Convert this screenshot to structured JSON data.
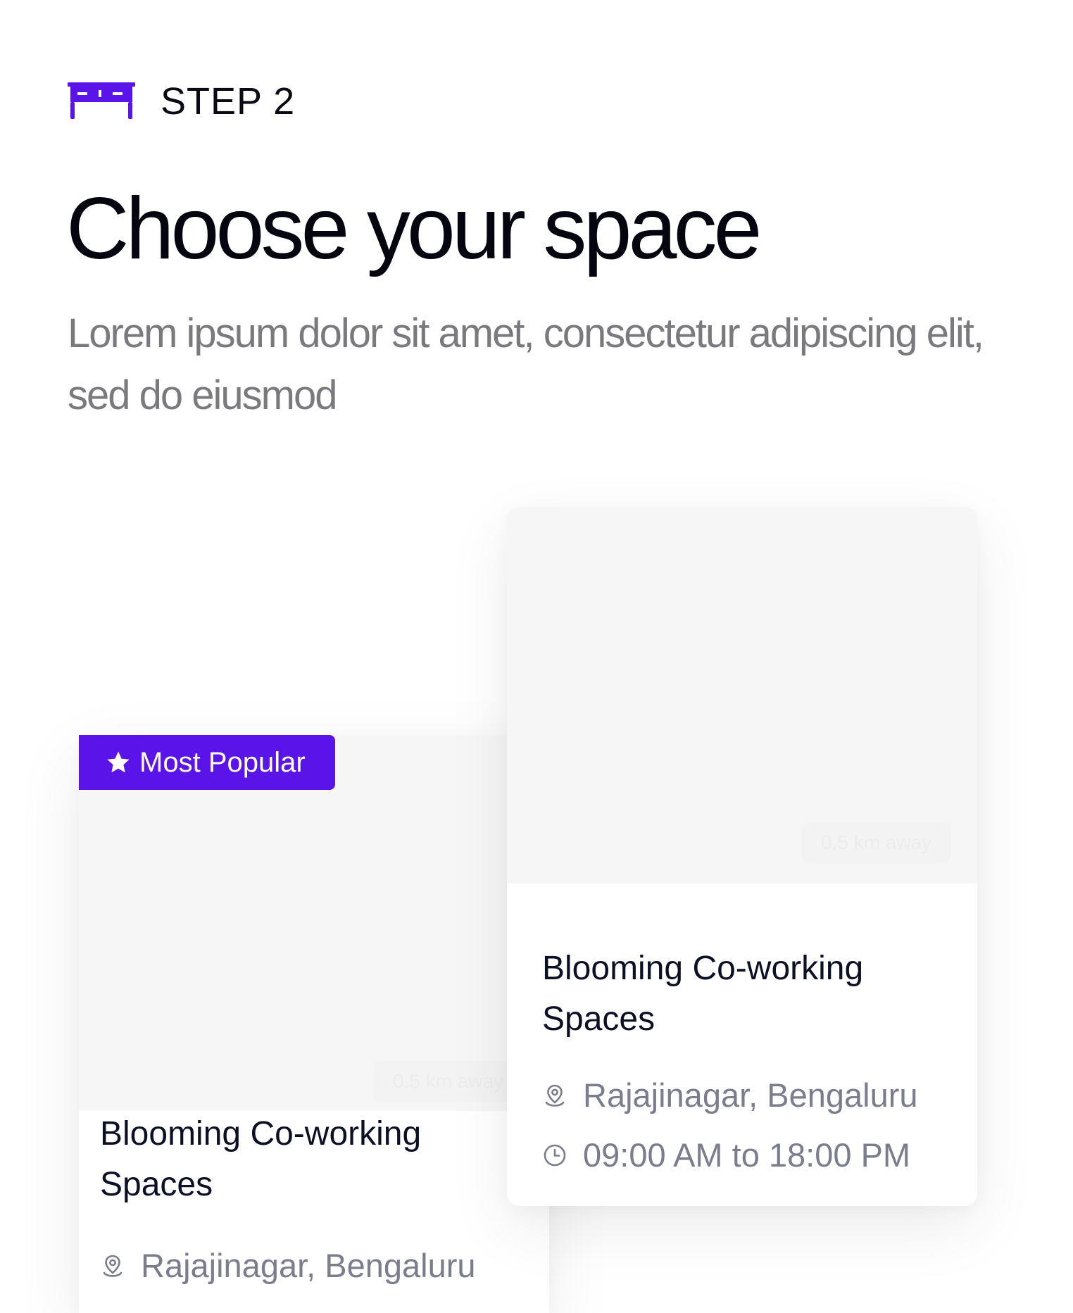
{
  "step": {
    "label": "STEP 2",
    "icon": "desk-icon",
    "accent": "#5b14e8"
  },
  "heading": {
    "title": "Choose your space",
    "subtitle": "Lorem ipsum dolor sit amet, consectetur adipiscing elit, sed do eiusmod"
  },
  "badge": {
    "label": "Most Popular",
    "icon": "star-icon",
    "color": "#5b14e8"
  },
  "cards": [
    {
      "distance": "0.5 km away",
      "title": "Blooming Co-working Spaces",
      "location": "Rajajinagar, Bengaluru",
      "location_icon": "map-pin-icon"
    },
    {
      "distance": "0.5 km away",
      "title": "Blooming Co-working Spaces",
      "location": "Rajajinagar, Bengaluru",
      "location_icon": "map-pin-icon",
      "hours": "09:00 AM to 18:00 PM",
      "hours_icon": "clock-icon"
    }
  ]
}
